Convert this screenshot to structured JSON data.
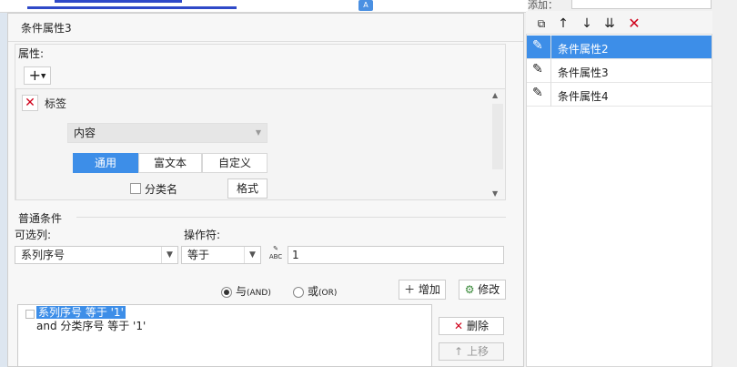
{
  "background": {
    "badge": "A",
    "add_label": "添加："
  },
  "dialog": {
    "title": "条件属性3",
    "property_section": {
      "label": "属性:",
      "add_button": "+",
      "tag_label": "标签",
      "content_select": "内容",
      "tabs": [
        "通用",
        "富文本",
        "自定义"
      ],
      "category_name_label": "分类名",
      "format_button": "格式"
    },
    "condition_section": {
      "label": "普通条件",
      "column_label": "可选列:",
      "operator_label": "操作符:",
      "column_value": "系列序号",
      "operator_value": "等于",
      "value_input": "1",
      "and_label": "与",
      "and_suffix": "(AND)",
      "or_label": "或",
      "or_suffix": "(OR)",
      "increase_button": "增加",
      "modify_button": "修改",
      "conditions": [
        "系列序号 等于 '1'",
        "and 分类序号 等于 '1'"
      ],
      "delete_button": "删除",
      "move_up_button": "上移"
    }
  },
  "right_panel": {
    "items": [
      "条件属性2",
      "条件属性3",
      "条件属性4"
    ]
  }
}
